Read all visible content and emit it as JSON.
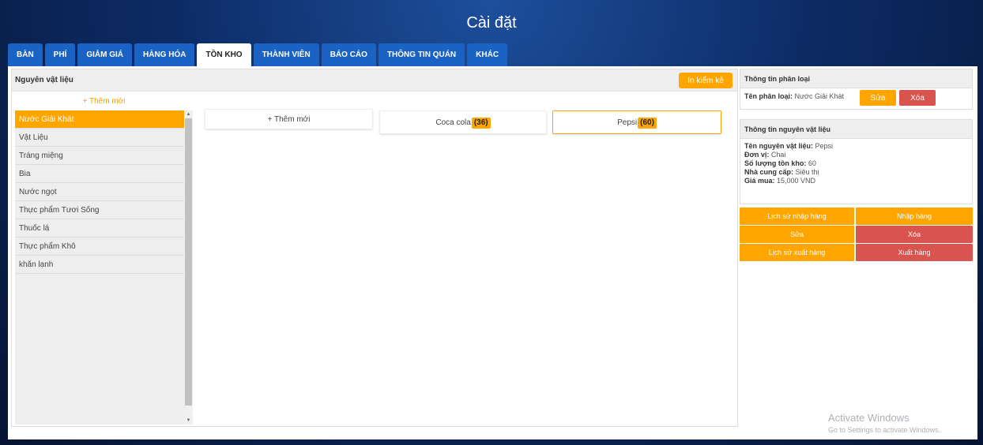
{
  "app": {
    "title": "Cài đặt"
  },
  "tabs": [
    {
      "label": "BÀN"
    },
    {
      "label": "PHÍ"
    },
    {
      "label": "GIẢM GIÁ"
    },
    {
      "label": "HÀNG HÓA"
    },
    {
      "label": "TỒN KHO",
      "active": true
    },
    {
      "label": "THÀNH VIÊN"
    },
    {
      "label": "BÁO CÁO"
    },
    {
      "label": "THÔNG TIN QUÁN"
    },
    {
      "label": "KHÁC"
    }
  ],
  "left": {
    "title": "Nguyên vật liệu",
    "inventory_button": "In kiểm kê",
    "add_category": "+ Thêm mới",
    "categories": [
      {
        "label": "Nước Giải Khát",
        "active": true
      },
      {
        "label": "Vật Liệu"
      },
      {
        "label": "Tráng miệng"
      },
      {
        "label": "Bia"
      },
      {
        "label": "Nước ngọt"
      },
      {
        "label": "Thực phẩm Tươi Sống"
      },
      {
        "label": "Thuốc lá"
      },
      {
        "label": "Thực phẩm Khô"
      },
      {
        "label": "khăn lạnh"
      }
    ]
  },
  "materials": {
    "add_label": "+ Thêm mới",
    "items": [
      {
        "name": "Coca cola",
        "qty": "(36)"
      },
      {
        "name": "Pepsi",
        "qty": "(60)",
        "selected": true
      }
    ]
  },
  "category_info": {
    "title": "Thông tin phân loại",
    "name_label": "Tên phân loại:",
    "name_value": "Nước Giải Khát",
    "edit_button": "Sửa",
    "delete_button": "Xóa"
  },
  "material_info": {
    "title": "Thông tin nguyên vật liệu",
    "name_label": "Tên nguyên vật liệu:",
    "name_value": "Pepsi",
    "unit_label": "Đơn vị:",
    "unit_value": "Chai",
    "stock_label": "Số lượng tồn kho:",
    "stock_value": "60",
    "supplier_label": "Nhà cung cấp:",
    "supplier_value": "Siêu thị",
    "price_label": "Giá mua:",
    "price_value": "15,000 VND"
  },
  "actions": {
    "import_history": "Lịch sử nhập hàng",
    "import": "Nhập hàng",
    "edit": "Sửa",
    "delete": "Xóa",
    "export_history": "Lịch sử xuất hàng",
    "export": "Xuất hàng"
  },
  "watermark": {
    "line1": "Activate Windows",
    "line2": "Go to Settings to activate Windows."
  },
  "colors": {
    "accent": "#ffa500",
    "danger": "#d9534f",
    "tab": "#1a63c4"
  }
}
